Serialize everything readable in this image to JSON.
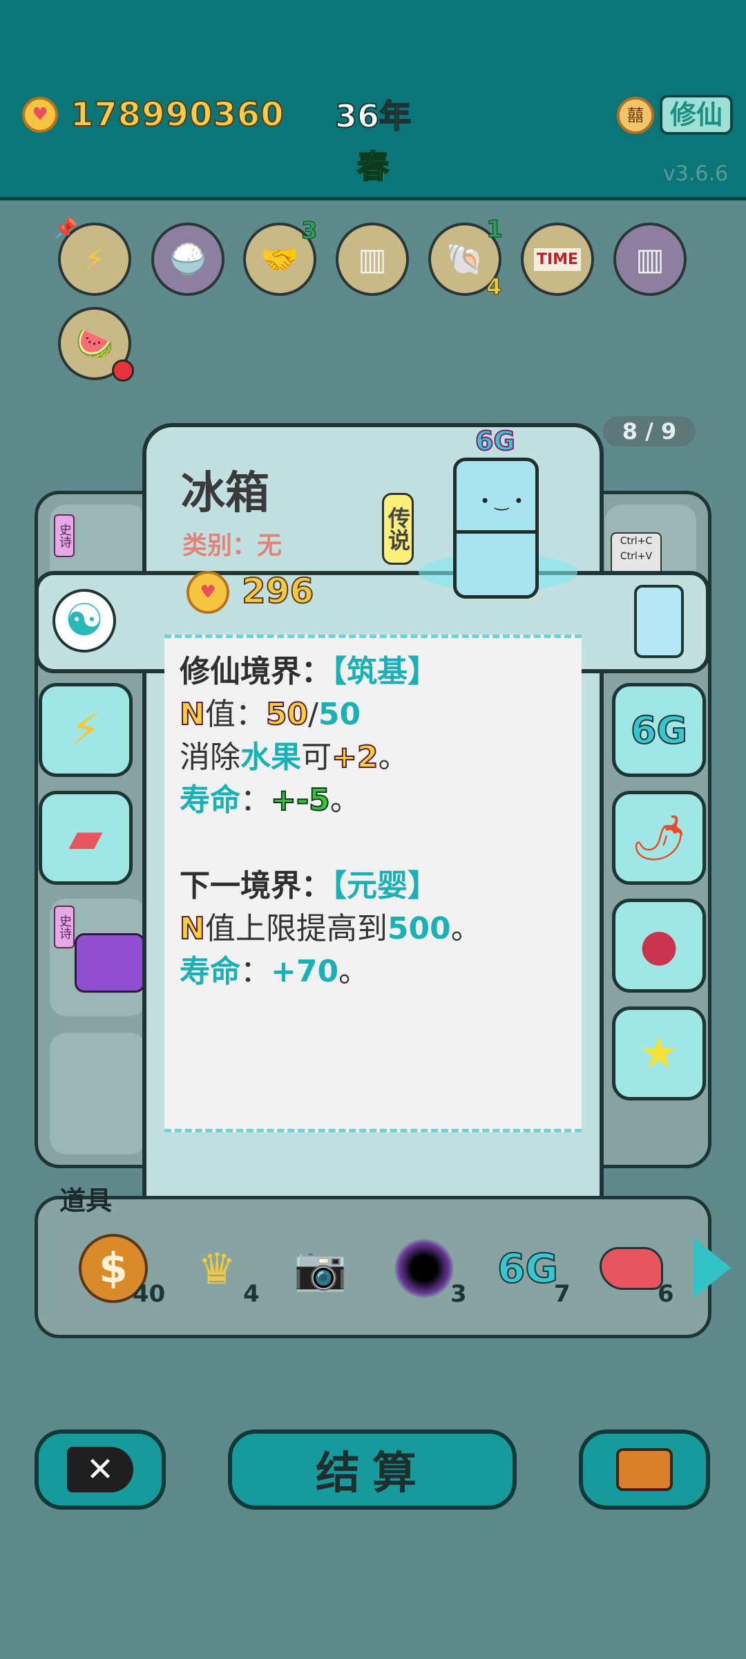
{
  "header": {
    "money": "178990360",
    "year": "36年",
    "season": "春",
    "xiuxian_button": "修仙",
    "tianji_icon_text": "囍",
    "version": "v3.6.6"
  },
  "buffs": [
    {
      "icon": "lightning-icon",
      "glyph": "⚡"
    },
    {
      "icon": "rice-bowls-icon",
      "glyph": "🍚"
    },
    {
      "icon": "handshake-icon",
      "glyph": "🤝",
      "count": "3"
    },
    {
      "icon": "skirt-icon",
      "glyph": "▥"
    },
    {
      "icon": "shell-icon",
      "glyph": "🐚",
      "count_top": "1",
      "count_bottom": "4"
    },
    {
      "icon": "time-magazine-icon",
      "glyph": "TIME"
    },
    {
      "icon": "skirt-icon",
      "glyph": "▥"
    },
    {
      "icon": "fruit-bowl-icon",
      "glyph": "🍉"
    }
  ],
  "popup": {
    "page_indicator": "8 / 9",
    "item_name": "冰箱",
    "category": "类别：无",
    "rarity": "传说",
    "badge": "6G",
    "price": "296",
    "desc": {
      "realm_label": "修仙境界：",
      "realm_value": "【筑基】",
      "n_label": "N",
      "n_suffix": "值：",
      "n_current": "50",
      "n_sep": "/",
      "n_max": "50",
      "elim_prefix": "消除",
      "elim_target": "水果",
      "elim_mid": "可",
      "elim_value": "+2",
      "elim_end": "。",
      "life_label": "寿命",
      "life_colon": "：",
      "life_value": "+-5",
      "life_end": "。",
      "next_label": "下一境界：",
      "next_value": "【元婴】",
      "next_n": "N",
      "next_n_text": "值上限提高到",
      "next_n_value": "500",
      "next_n_end": "。",
      "next_life_label": "寿命",
      "next_life_colon": "：",
      "next_life_value": "+70",
      "next_life_end": "。"
    }
  },
  "side_left": [
    "yin-yang-icon",
    "lightning-icon",
    "liver-icon"
  ],
  "side_right": [
    "fridge-icon",
    "6g-icon",
    "chili-icon",
    "lychee-icon",
    "star-icon"
  ],
  "bg_tags": {
    "epic1": "史诗",
    "epic2": "史诗",
    "ctrl_c": "Ctrl+C",
    "ctrl_v": "Ctrl+V"
  },
  "items_bar": {
    "label": "道具",
    "items": [
      {
        "icon": "dollar-coin-icon",
        "glyph": "$",
        "count": "40"
      },
      {
        "icon": "crown-icon",
        "glyph": "♛",
        "count": "4"
      },
      {
        "icon": "camera-icon",
        "glyph": "📷",
        "count": ""
      },
      {
        "icon": "black-hole-icon",
        "glyph": "●",
        "count": "3"
      },
      {
        "icon": "6g-icon",
        "glyph": "6G",
        "count": "7"
      },
      {
        "icon": "liver-icon",
        "glyph": "🫀",
        "count": "6"
      }
    ]
  },
  "bottom": {
    "settle_label": "结算"
  },
  "colors": {
    "topbar": "#0a7677",
    "background": "#5f8a8c",
    "popup": "#c3e0e0",
    "teal_text": "#1bb0b6",
    "gold_text": "#f6cc4a"
  }
}
